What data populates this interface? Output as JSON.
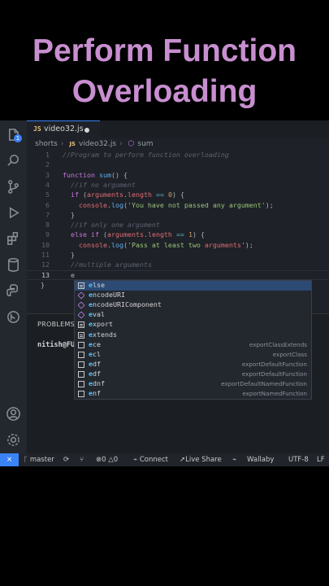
{
  "title_line1": "Perform Function",
  "title_line2": "Overloading",
  "activity": {
    "badge": "1"
  },
  "tab": {
    "lang": "JS",
    "filename": "video32.js"
  },
  "breadcrumb": {
    "folder": "shorts",
    "file": "video32.js",
    "symbol": "sum"
  },
  "code_lines": [
    {
      "n": "1",
      "t": "//Program to perform function overloading"
    },
    {
      "n": "2",
      "t": ""
    },
    {
      "n": "3",
      "t": "function sum() {"
    },
    {
      "n": "4",
      "t": "  //if no argument"
    },
    {
      "n": "5",
      "t": "  if (arguments.length == 0) {"
    },
    {
      "n": "6",
      "t": "    console.log('You have not passed any argument');"
    },
    {
      "n": "7",
      "t": "  }"
    },
    {
      "n": "8",
      "t": "  //if only one argument"
    },
    {
      "n": "9",
      "t": "  else if (arguments.length == 1) {"
    },
    {
      "n": "10",
      "t": "    console.log('Pass at least two arguments');"
    },
    {
      "n": "11",
      "t": "  }"
    },
    {
      "n": "12",
      "t": "  //multiple arguments"
    },
    {
      "n": "13",
      "t": "  e"
    },
    {
      "n": "",
      "t": "}"
    }
  ],
  "panel": {
    "tab": "PROBLEMS",
    "terminal": "nitish@FUL"
  },
  "suggestions": [
    {
      "label": "else",
      "detail": "",
      "kind": "keyword"
    },
    {
      "label": "encodeURI",
      "detail": "",
      "kind": "function"
    },
    {
      "label": "encodeURIComponent",
      "detail": "",
      "kind": "function"
    },
    {
      "label": "eval",
      "detail": "",
      "kind": "function"
    },
    {
      "label": "export",
      "detail": "",
      "kind": "keyword"
    },
    {
      "label": "extends",
      "detail": "",
      "kind": "keyword"
    },
    {
      "label": "ece",
      "detail": "exportClassExtends",
      "kind": "snippet"
    },
    {
      "label": "ecl",
      "detail": "exportClass",
      "kind": "snippet"
    },
    {
      "label": "edf",
      "detail": "exportDefaultFunction",
      "kind": "snippet"
    },
    {
      "label": "edf",
      "detail": "exportDefaultFunction",
      "kind": "snippet"
    },
    {
      "label": "ednf",
      "detail": "exportDefaultNamedFunction",
      "kind": "snippet"
    },
    {
      "label": "enf",
      "detail": "exportNamedFunction",
      "kind": "snippet"
    }
  ],
  "status": {
    "remote": "⨯",
    "branch": "master",
    "errors": "0",
    "warnings": "0",
    "connect": "Connect",
    "liveshare": "Live Share",
    "wallaby": "Wallaby",
    "encoding": "UTF-8",
    "eol": "LF"
  },
  "colors": {
    "accent": "#3b82f6",
    "title": "#c88fd0",
    "editor_bg": "#1e2127"
  }
}
